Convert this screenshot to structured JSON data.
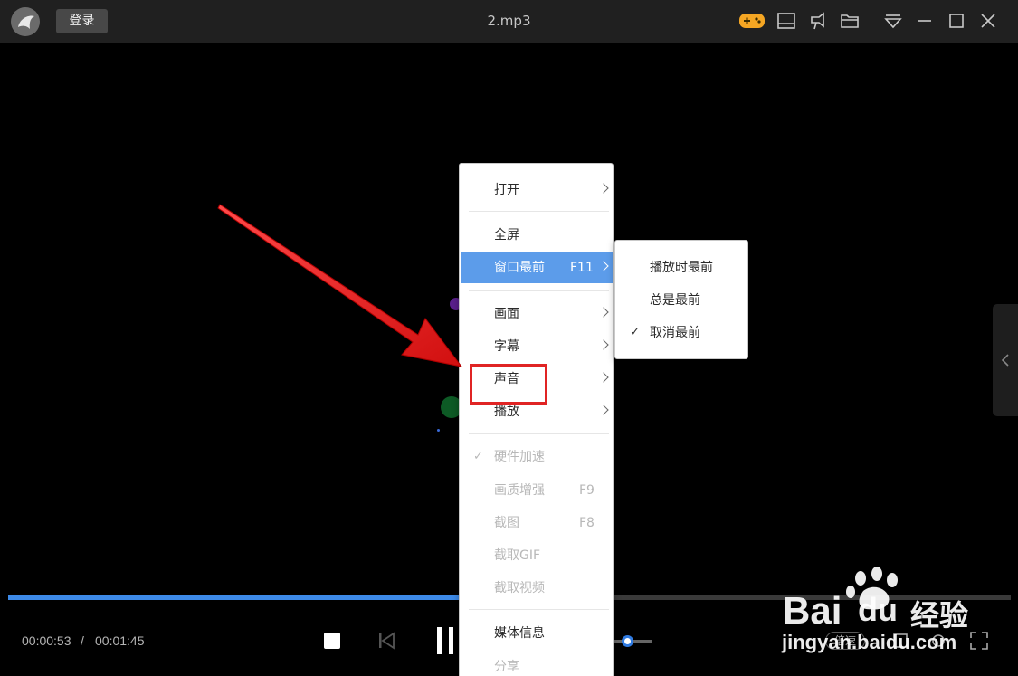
{
  "titlebar": {
    "login_label": "登录",
    "title": "2.mp3",
    "icons": [
      "game-icon",
      "screen-icon",
      "pin-icon",
      "folder-icon",
      "menu-icon",
      "minimize-icon",
      "maximize-icon",
      "close-icon"
    ]
  },
  "context_menu": {
    "items": [
      {
        "label": "打开",
        "submenu": true
      },
      {
        "label": "全屏"
      },
      {
        "label": "窗口最前",
        "shortcut": "F11",
        "submenu": true,
        "active": true
      },
      {
        "label": "画面",
        "submenu": true
      },
      {
        "label": "字幕",
        "submenu": true
      },
      {
        "label": "声音",
        "submenu": true,
        "highlighted": true
      },
      {
        "label": "播放",
        "submenu": true
      },
      {
        "label": "硬件加速",
        "checked": true,
        "disabled": true
      },
      {
        "label": "画质增强",
        "shortcut": "F9",
        "disabled": true
      },
      {
        "label": "截图",
        "shortcut": "F8",
        "disabled": true
      },
      {
        "label": "截取GIF",
        "disabled": true
      },
      {
        "label": "截取视频",
        "disabled": true
      },
      {
        "label": "媒体信息"
      },
      {
        "label": "分享",
        "disabled": true
      }
    ],
    "check_glyph": "✓"
  },
  "submenu": {
    "items": [
      {
        "label": "播放时最前"
      },
      {
        "label": "总是最前"
      },
      {
        "label": "取消最前",
        "checked": true
      }
    ]
  },
  "controls": {
    "current_time": "00:00:53",
    "separator": "/",
    "total_time": "00:01:45",
    "progress": 0.505,
    "volume": 0.5,
    "speed_label": "倍速"
  },
  "watermark": {
    "brand_left": "Bai",
    "brand_right": "du",
    "brand_cn": "经验",
    "url": "jingyan.baidu.com"
  },
  "colors": {
    "accent": "#3d8ae8",
    "menu_active": "#5c9cea",
    "annotation_red": "#e02424"
  }
}
